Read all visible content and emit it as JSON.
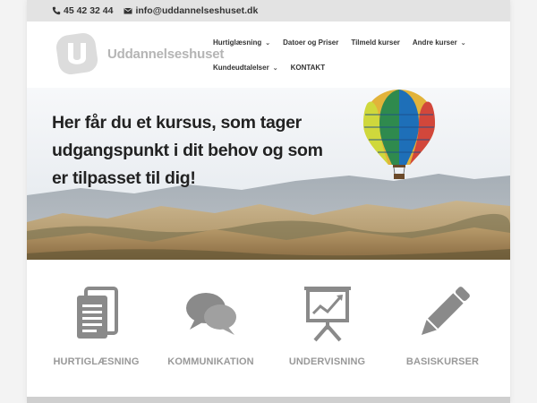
{
  "topbar": {
    "phone": "45 42 32 44",
    "email": "info@uddannelseshuset.dk",
    "phone_icon": "phone-icon",
    "email_icon": "envelope-icon"
  },
  "header": {
    "logo_text": "Uddannelseshuset",
    "logo_mark": "U"
  },
  "nav": {
    "items": [
      {
        "label": "Hurtiglæsning",
        "dropdown": true
      },
      {
        "label": "Datoer og Priser",
        "dropdown": false
      },
      {
        "label": "Tilmeld kurser",
        "dropdown": false
      },
      {
        "label": "Andre kurser",
        "dropdown": true
      },
      {
        "label": "Kundeudtalelser",
        "dropdown": true
      },
      {
        "label": "KONTAKT",
        "dropdown": false
      }
    ],
    "chevron": "⌄"
  },
  "hero": {
    "headline": "Her får du et kursus, som tager udgangspunkt i dit behov og som er tilpasset til dig!",
    "image": "hot-air-balloon-over-hills"
  },
  "features": [
    {
      "label": "HURTIGLÆSNING",
      "icon": "document-icon"
    },
    {
      "label": "KOMMUNIKATION",
      "icon": "speech-bubbles-icon"
    },
    {
      "label": "UNDERVISNING",
      "icon": "presentation-board-icon"
    },
    {
      "label": "BASISKURSER",
      "icon": "pencil-icon"
    }
  ],
  "colors": {
    "icon_gray": "#8a8a8a",
    "label_gray": "#999999",
    "topbar_bg": "#e3e3e3"
  }
}
